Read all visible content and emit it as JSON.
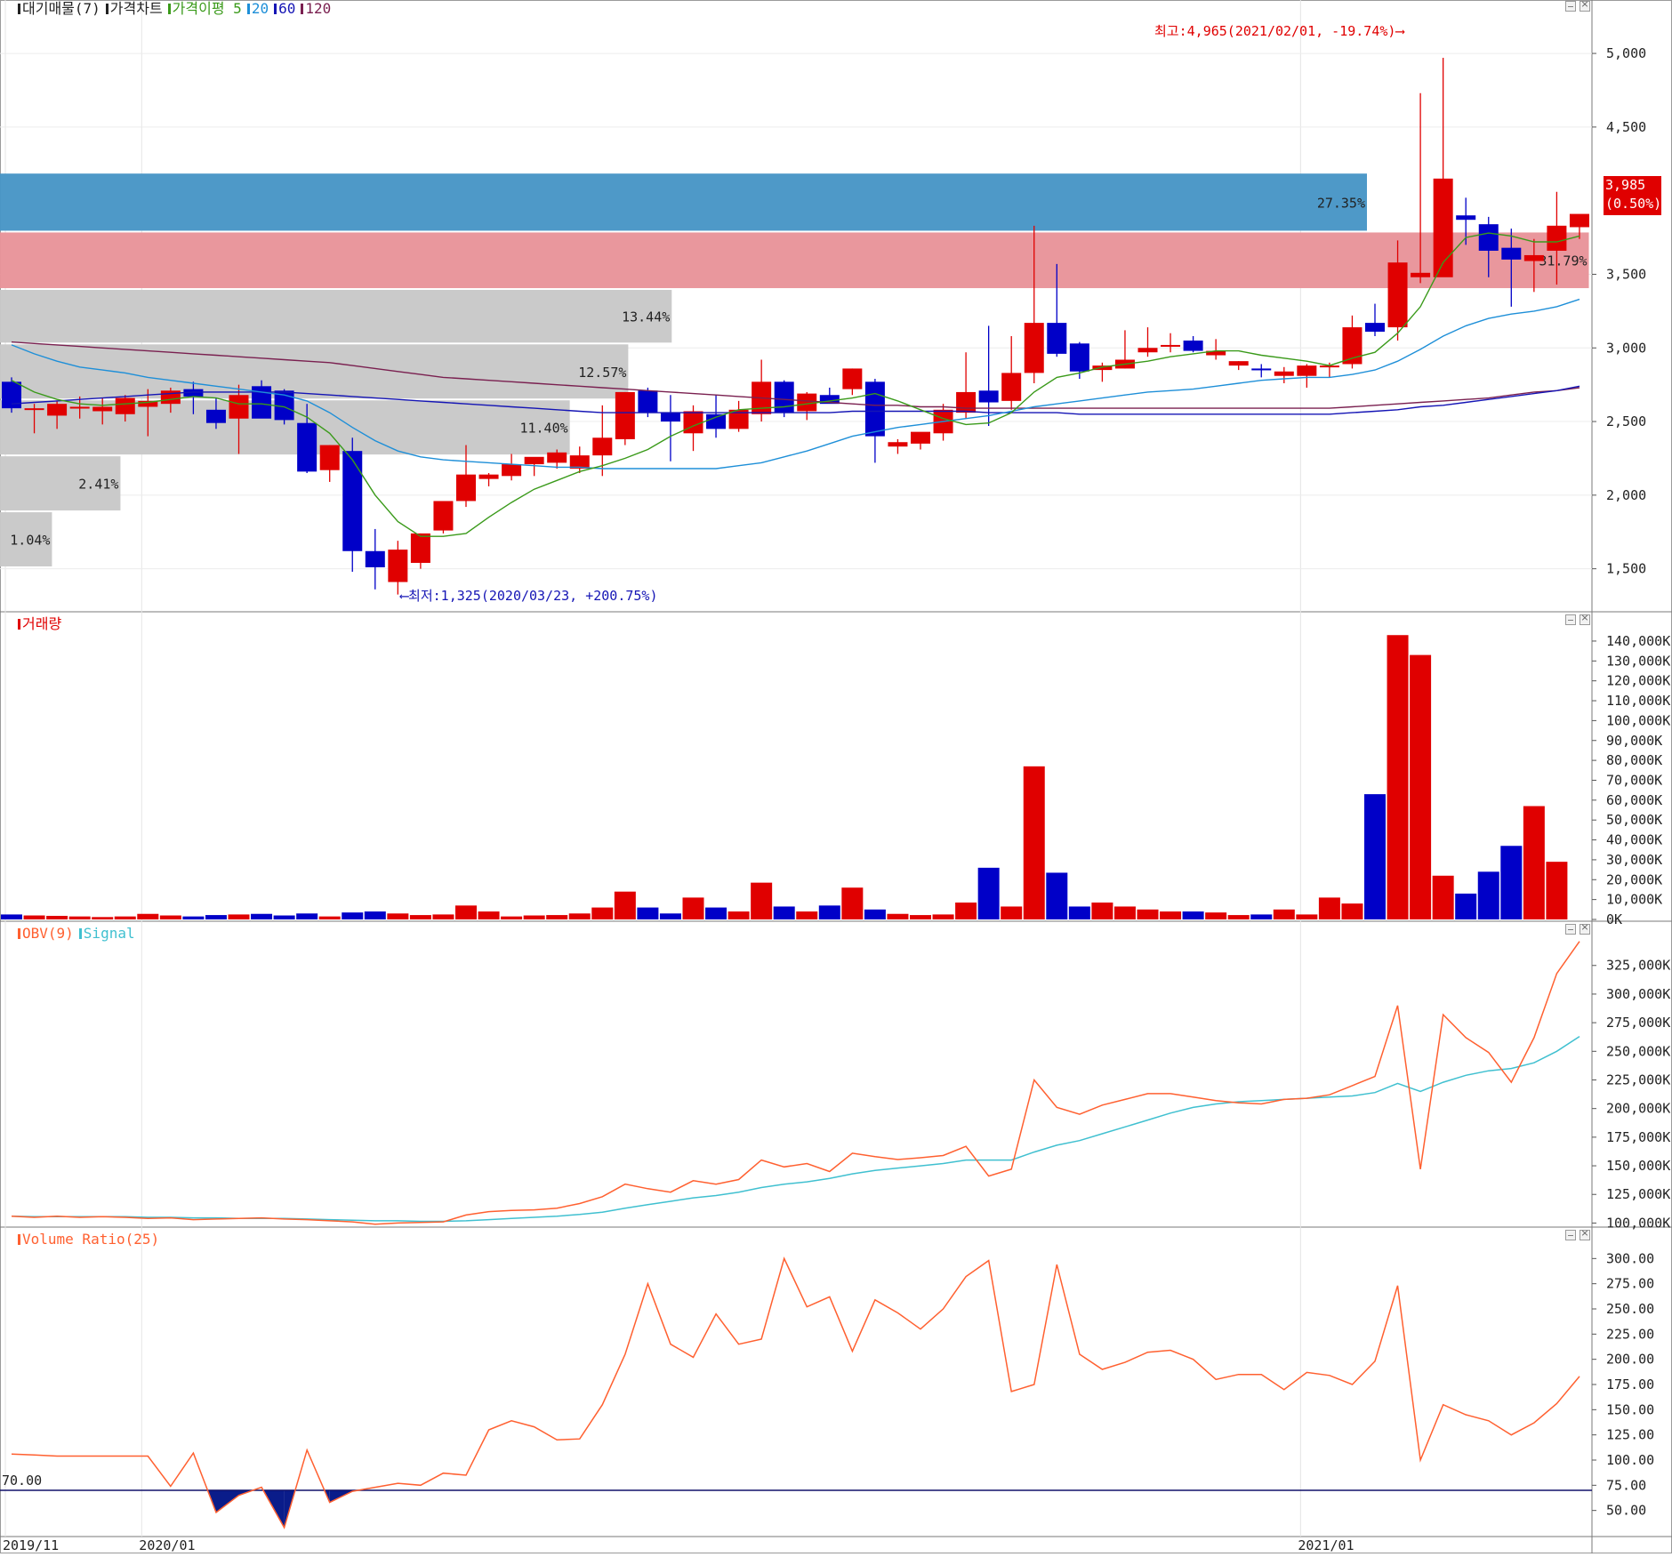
{
  "chart_data": [
    {
      "type": "candlestick",
      "panel": "price",
      "legend": [
        {
          "label": "대기매물(7)",
          "color": "#222222"
        },
        {
          "label": "가격차트",
          "color": "#222222"
        },
        {
          "label": "가격이평 5",
          "color": "#3a9a1a"
        },
        {
          "label": "20",
          "color": "#1e8fd8"
        },
        {
          "label": "60",
          "color": "#1515b5"
        },
        {
          "label": "120",
          "color": "#7a2050"
        }
      ],
      "y_ticks": [
        "5,000",
        "4,500",
        "3,500",
        "3,000",
        "2,500",
        "2,000",
        "1,500"
      ],
      "y_tick_values": [
        5000,
        4500,
        3500,
        3000,
        2500,
        2000,
        1500
      ],
      "ylim": [
        1220,
        5230
      ],
      "x_ticks": [
        "2019/11",
        "2020/01",
        "2021/01"
      ],
      "x_tick_index": [
        0,
        6,
        57
      ],
      "high_annotation": "최고:4,965(2021/02/01, -19.74%)",
      "low_annotation": "최저:1,325(2020/03/23, +200.75%)",
      "current_price": "3,985",
      "current_change": "(0.50%)",
      "volume_profile": [
        {
          "pct": "27.35%",
          "lo": 3790,
          "hi": 4190,
          "color": "#4896c6"
        },
        {
          "pct": "31.79%",
          "lo": 3400,
          "hi": 3790,
          "color": "#e8949a"
        },
        {
          "pct": "13.44%",
          "lo": 3030,
          "hi": 3400,
          "color": "#c8c8c8"
        },
        {
          "pct": "12.57%",
          "lo": 2650,
          "hi": 3030,
          "color": "#c8c8c8"
        },
        {
          "pct": "11.40%",
          "lo": 2270,
          "hi": 2650,
          "color": "#c8c8c8"
        },
        {
          "pct": "2.41%",
          "lo": 1890,
          "hi": 2270,
          "color": "#c8c8c8"
        },
        {
          "pct": "1.04%",
          "lo": 1510,
          "hi": 1890,
          "color": "#c8c8c8"
        }
      ],
      "candles": [
        [
          2770,
          2800,
          2560,
          2590
        ],
        [
          2580,
          2620,
          2420,
          2590
        ],
        [
          2540,
          2640,
          2450,
          2620
        ],
        [
          2600,
          2670,
          2520,
          2600
        ],
        [
          2570,
          2660,
          2480,
          2600
        ],
        [
          2550,
          2680,
          2500,
          2660
        ],
        [
          2600,
          2720,
          2400,
          2640
        ],
        [
          2620,
          2730,
          2560,
          2710
        ],
        [
          2720,
          2770,
          2550,
          2670
        ],
        [
          2580,
          2660,
          2450,
          2490
        ],
        [
          2520,
          2750,
          2280,
          2680
        ],
        [
          2740,
          2780,
          2600,
          2520
        ],
        [
          2710,
          2720,
          2480,
          2510
        ],
        [
          2490,
          2620,
          2150,
          2160
        ],
        [
          2170,
          2340,
          2090,
          2340
        ],
        [
          2300,
          2390,
          1480,
          1620
        ],
        [
          1620,
          1770,
          1360,
          1510
        ],
        [
          1410,
          1690,
          1325,
          1630
        ],
        [
          1540,
          1740,
          1500,
          1740
        ],
        [
          1760,
          1940,
          1740,
          1960
        ],
        [
          1960,
          2340,
          1920,
          2140
        ],
        [
          2110,
          2150,
          2060,
          2140
        ],
        [
          2130,
          2280,
          2100,
          2210
        ],
        [
          2210,
          2250,
          2130,
          2260
        ],
        [
          2220,
          2310,
          2180,
          2290
        ],
        [
          2180,
          2330,
          2150,
          2270
        ],
        [
          2270,
          2610,
          2130,
          2390
        ],
        [
          2380,
          2700,
          2340,
          2700
        ],
        [
          2710,
          2730,
          2530,
          2560
        ],
        [
          2560,
          2680,
          2230,
          2500
        ],
        [
          2420,
          2610,
          2300,
          2570
        ],
        [
          2550,
          2680,
          2390,
          2450
        ],
        [
          2450,
          2640,
          2430,
          2580
        ],
        [
          2550,
          2920,
          2500,
          2770
        ],
        [
          2770,
          2780,
          2530,
          2560
        ],
        [
          2570,
          2700,
          2510,
          2690
        ],
        [
          2680,
          2730,
          2630,
          2620
        ],
        [
          2720,
          2860,
          2680,
          2860
        ],
        [
          2770,
          2790,
          2220,
          2400
        ],
        [
          2330,
          2380,
          2280,
          2360
        ],
        [
          2350,
          2420,
          2310,
          2430
        ],
        [
          2420,
          2620,
          2370,
          2580
        ],
        [
          2560,
          2970,
          2520,
          2700
        ],
        [
          2710,
          3150,
          2470,
          2630
        ],
        [
          2640,
          3080,
          2580,
          2830
        ],
        [
          2830,
          3830,
          2760,
          3170
        ],
        [
          3170,
          3570,
          2940,
          2960
        ],
        [
          3030,
          3040,
          2790,
          2840
        ],
        [
          2850,
          2900,
          2770,
          2880
        ],
        [
          2860,
          3120,
          2860,
          2920
        ],
        [
          2970,
          3140,
          2940,
          3000
        ],
        [
          3020,
          3100,
          2970,
          3020
        ],
        [
          3050,
          3080,
          2970,
          2980
        ],
        [
          2950,
          3060,
          2920,
          2980
        ],
        [
          2880,
          2910,
          2850,
          2910
        ],
        [
          2860,
          2890,
          2800,
          2850
        ],
        [
          2810,
          2870,
          2760,
          2840
        ],
        [
          2810,
          2890,
          2730,
          2880
        ],
        [
          2880,
          2900,
          2800,
          2880
        ],
        [
          2890,
          3220,
          2860,
          3140
        ],
        [
          3170,
          3300,
          3080,
          3110
        ],
        [
          3140,
          3730,
          3050,
          3580
        ],
        [
          3480,
          4730,
          3440,
          3510
        ],
        [
          3480,
          4970,
          3500,
          4150
        ],
        [
          3900,
          4020,
          3700,
          3870
        ],
        [
          3840,
          3890,
          3480,
          3660
        ],
        [
          3680,
          3810,
          3280,
          3600
        ],
        [
          3590,
          3740,
          3380,
          3630
        ],
        [
          3660,
          4060,
          3430,
          3830
        ],
        [
          3820,
          3900,
          3740,
          3910
        ]
      ],
      "ma5": [
        2780,
        2700,
        2650,
        2620,
        2610,
        2620,
        2630,
        2650,
        2670,
        2660,
        2620,
        2620,
        2600,
        2530,
        2420,
        2240,
        2000,
        1820,
        1720,
        1720,
        1740,
        1850,
        1950,
        2040,
        2100,
        2160,
        2200,
        2250,
        2310,
        2400,
        2470,
        2530,
        2580,
        2590,
        2600,
        2620,
        2640,
        2660,
        2690,
        2640,
        2580,
        2520,
        2480,
        2490,
        2560,
        2700,
        2800,
        2830,
        2870,
        2890,
        2910,
        2940,
        2960,
        2980,
        2980,
        2950,
        2930,
        2910,
        2880,
        2930,
        2970,
        3100,
        3280,
        3580,
        3750,
        3780,
        3760,
        3720,
        3720,
        3760
      ],
      "ma20": [
        3020,
        2960,
        2910,
        2870,
        2850,
        2830,
        2800,
        2780,
        2760,
        2740,
        2720,
        2700,
        2680,
        2640,
        2560,
        2460,
        2370,
        2300,
        2260,
        2240,
        2230,
        2220,
        2210,
        2200,
        2190,
        2190,
        2180,
        2180,
        2180,
        2180,
        2180,
        2180,
        2200,
        2220,
        2260,
        2300,
        2350,
        2400,
        2430,
        2460,
        2480,
        2500,
        2520,
        2540,
        2570,
        2600,
        2620,
        2640,
        2660,
        2680,
        2700,
        2710,
        2720,
        2740,
        2760,
        2780,
        2790,
        2800,
        2800,
        2820,
        2850,
        2910,
        2990,
        3080,
        3150,
        3200,
        3230,
        3250,
        3280,
        3330
      ],
      "ma60": [
        2620,
        2630,
        2640,
        2650,
        2660,
        2670,
        2680,
        2690,
        2700,
        2700,
        2700,
        2700,
        2700,
        2690,
        2680,
        2670,
        2660,
        2650,
        2640,
        2630,
        2620,
        2610,
        2600,
        2590,
        2580,
        2570,
        2560,
        2560,
        2560,
        2560,
        2560,
        2560,
        2560,
        2560,
        2560,
        2560,
        2560,
        2570,
        2570,
        2570,
        2570,
        2570,
        2570,
        2560,
        2560,
        2560,
        2560,
        2550,
        2550,
        2550,
        2550,
        2550,
        2550,
        2550,
        2550,
        2550,
        2550,
        2550,
        2550,
        2560,
        2570,
        2580,
        2600,
        2610,
        2630,
        2650,
        2670,
        2690,
        2710,
        2740
      ],
      "ma120": [
        3040,
        3030,
        3020,
        3010,
        3000,
        2990,
        2980,
        2970,
        2960,
        2950,
        2940,
        2930,
        2920,
        2910,
        2900,
        2880,
        2860,
        2840,
        2820,
        2800,
        2790,
        2780,
        2770,
        2760,
        2750,
        2740,
        2730,
        2720,
        2710,
        2700,
        2690,
        2680,
        2670,
        2660,
        2650,
        2640,
        2630,
        2620,
        2610,
        2610,
        2600,
        2600,
        2590,
        2590,
        2590,
        2590,
        2590,
        2590,
        2590,
        2590,
        2590,
        2590,
        2590,
        2590,
        2590,
        2590,
        2590,
        2590,
        2590,
        2600,
        2610,
        2620,
        2630,
        2640,
        2650,
        2660,
        2680,
        2700,
        2710,
        2730
      ]
    },
    {
      "type": "bar",
      "panel": "volume",
      "legend": [
        {
          "label": "거래량",
          "color": "#e00000"
        }
      ],
      "y_ticks": [
        "140,000K",
        "130,000K",
        "120,000K",
        "110,000K",
        "100,000K",
        "90,000K",
        "80,000K",
        "70,000K",
        "60,000K",
        "50,000K",
        "40,000K",
        "30,000K",
        "20,000K",
        "10,000K",
        "0K"
      ],
      "y_tick_values": [
        140000,
        130000,
        120000,
        110000,
        100000,
        90000,
        80000,
        70000,
        60000,
        50000,
        40000,
        30000,
        20000,
        10000,
        0
      ],
      "ylim": [
        0,
        144000
      ],
      "unit": "K",
      "values": [
        2500,
        2000,
        1800,
        1500,
        1200,
        1500,
        2800,
        2000,
        1500,
        2200,
        2500,
        2800,
        2000,
        3000,
        1500,
        3500,
        4000,
        3000,
        2200,
        2500,
        7000,
        4000,
        1500,
        2000,
        2200,
        3000,
        6000,
        14000,
        6000,
        3000,
        11000,
        6000,
        4000,
        18500,
        6500,
        4000,
        7000,
        16000,
        5000,
        2800,
        2200,
        2500,
        8500,
        26000,
        6500,
        77000,
        23500,
        6500,
        8500,
        6500,
        5000,
        4000,
        4000,
        3500,
        2200,
        2500,
        5000,
        2500,
        11000,
        8000,
        63000,
        143000,
        133000,
        22000,
        13000,
        24000,
        37000,
        57000,
        29000
      ]
    },
    {
      "type": "line",
      "panel": "obv",
      "legend": [
        {
          "label": "OBV(9)",
          "color": "#ff6030"
        },
        {
          "label": "Signal",
          "color": "#40c0d0"
        }
      ],
      "y_ticks": [
        "325,000K",
        "300,000K",
        "275,000K",
        "250,000K",
        "225,000K",
        "200,000K",
        "175,000K",
        "150,000K",
        "125,000K",
        "100,000K"
      ],
      "y_tick_values": [
        325000,
        300000,
        275000,
        250000,
        225000,
        200000,
        175000,
        150000,
        125000,
        100000
      ],
      "ylim": [
        98000,
        345000
      ],
      "series": [
        {
          "name": "OBV(9)",
          "color": "#ff6030",
          "values": [
            106000,
            105000,
            106000,
            105000,
            105500,
            105000,
            104000,
            104500,
            103000,
            103500,
            104000,
            104500,
            103500,
            103000,
            102000,
            101000,
            99000,
            100000,
            100500,
            101000,
            107000,
            110000,
            111000,
            111500,
            113000,
            117000,
            123000,
            134000,
            130000,
            127000,
            137000,
            134000,
            138000,
            155000,
            149000,
            152000,
            145000,
            161000,
            158000,
            155500,
            157000,
            159000,
            167000,
            141000,
            147000,
            225000,
            201000,
            195000,
            203000,
            208000,
            213000,
            213000,
            210000,
            207000,
            205000,
            204000,
            208000,
            209000,
            212000,
            220000,
            228000,
            290000,
            147000,
            282000,
            262000,
            249000,
            223000,
            262000,
            318000,
            346000
          ]
        },
        {
          "name": "Signal",
          "color": "#40c0d0",
          "values": [
            106000,
            105500,
            105500,
            105500,
            105500,
            105500,
            105000,
            105000,
            104500,
            104500,
            104000,
            104000,
            104000,
            103500,
            103000,
            102500,
            102000,
            102000,
            101500,
            101500,
            102000,
            103000,
            104000,
            105000,
            106000,
            107500,
            109500,
            113000,
            116000,
            119000,
            122000,
            124000,
            127000,
            131000,
            134000,
            136000,
            139000,
            143000,
            146000,
            148000,
            150000,
            152000,
            155000,
            155000,
            155000,
            162000,
            168000,
            172000,
            178000,
            184000,
            190000,
            196000,
            201000,
            204000,
            206000,
            207000,
            208000,
            209000,
            210000,
            211000,
            214000,
            222000,
            215000,
            223000,
            229000,
            233000,
            235000,
            240000,
            250000,
            263000
          ]
        }
      ]
    },
    {
      "type": "area",
      "panel": "volume_ratio",
      "legend": [
        {
          "label": "Volume Ratio(25)",
          "color": "#ff6030"
        }
      ],
      "y_ticks": [
        "300.00",
        "275.00",
        "250.00",
        "225.00",
        "200.00",
        "175.00",
        "150.00",
        "125.00",
        "100.00",
        "75.00",
        "50.00"
      ],
      "y_tick_values": [
        300,
        275,
        250,
        225,
        200,
        175,
        150,
        125,
        100,
        75,
        50
      ],
      "ylim": [
        25,
        310
      ],
      "baseline": 70,
      "baseline_label": "70.00",
      "values": [
        106,
        105,
        104,
        104,
        104,
        104,
        104,
        74,
        107,
        48,
        65,
        73,
        33,
        110,
        58,
        69,
        73,
        77,
        75,
        87,
        85,
        130,
        139,
        133,
        120,
        121,
        155,
        205,
        275,
        215,
        202,
        245,
        215,
        220,
        300,
        252,
        262,
        208,
        259,
        246,
        230,
        250,
        282,
        298,
        168,
        175,
        294,
        205,
        190,
        197,
        207,
        209,
        200,
        180,
        185,
        185,
        170,
        187,
        184,
        175,
        198,
        273,
        100,
        155,
        145,
        139,
        125,
        137,
        156,
        183
      ]
    }
  ]
}
